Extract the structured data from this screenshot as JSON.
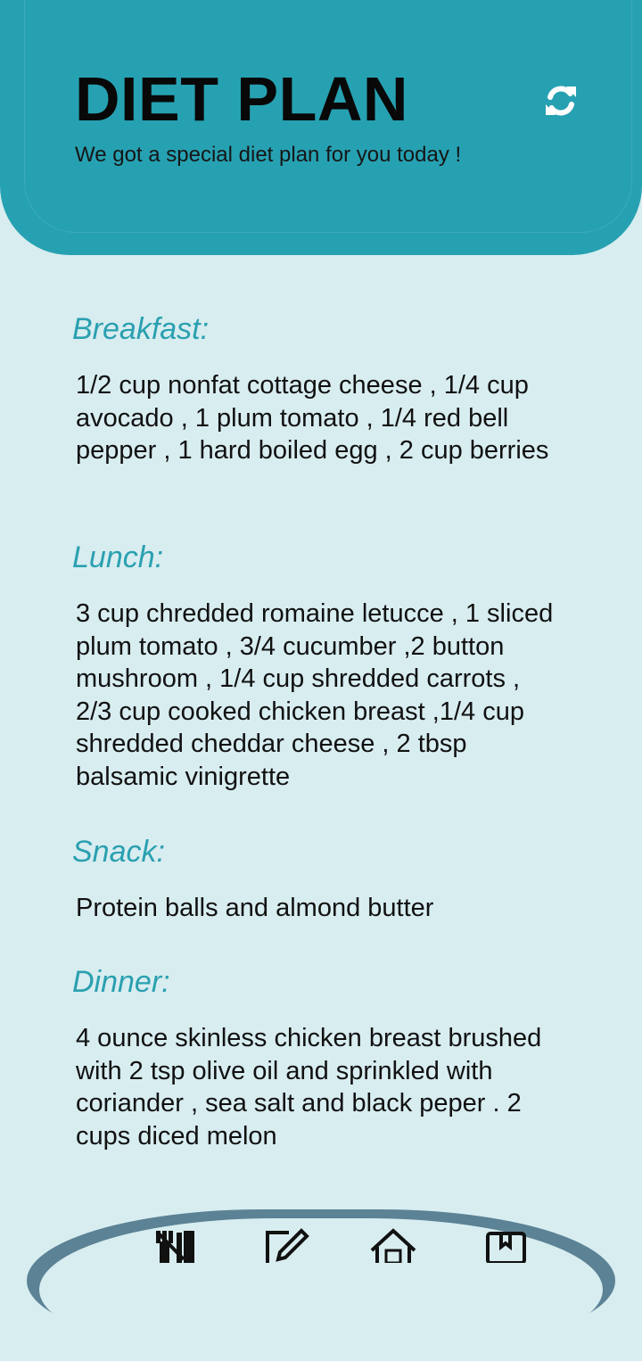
{
  "header": {
    "title": "DIET PLAN",
    "subtitle": "We got a special diet plan for you today !",
    "refresh_icon": "refresh-icon",
    "background_color": "#26a1b2"
  },
  "meals": [
    {
      "heading": "Breakfast:",
      "content": "1/2 cup nonfat cottage cheese , 1/4 cup avocado , 1 plum tomato , 1/4 red bell pepper , 1 hard boiled egg , 2 cup berries"
    },
    {
      "heading": "Lunch:",
      "content": "3 cup chredded romaine letucce  , 1 sliced plum tomato , 3/4 cucumber ,2 button  mushroom , 1/4 cup shredded carrots  , 2/3 cup cooked chicken breast ,1/4 cup shredded cheddar cheese , 2 tbsp balsamic vinigrette"
    },
    {
      "heading": "Snack:",
      "content": "Protein balls and almond butter"
    },
    {
      "heading": "Dinner:",
      "content": "4 ounce skinless chicken breast brushed with 2 tsp olive oil and sprinkled with coriander , sea salt and black peper . 2 cups diced melon"
    }
  ],
  "bottom_nav": {
    "items": [
      {
        "icon": "meal-icon"
      },
      {
        "icon": "edit-icon"
      },
      {
        "icon": "home-icon"
      },
      {
        "icon": "bookmark-icon"
      }
    ],
    "border_color": "#5b8295"
  },
  "colors": {
    "accent": "#2aa0b0",
    "page_background": "#d8edf0"
  }
}
